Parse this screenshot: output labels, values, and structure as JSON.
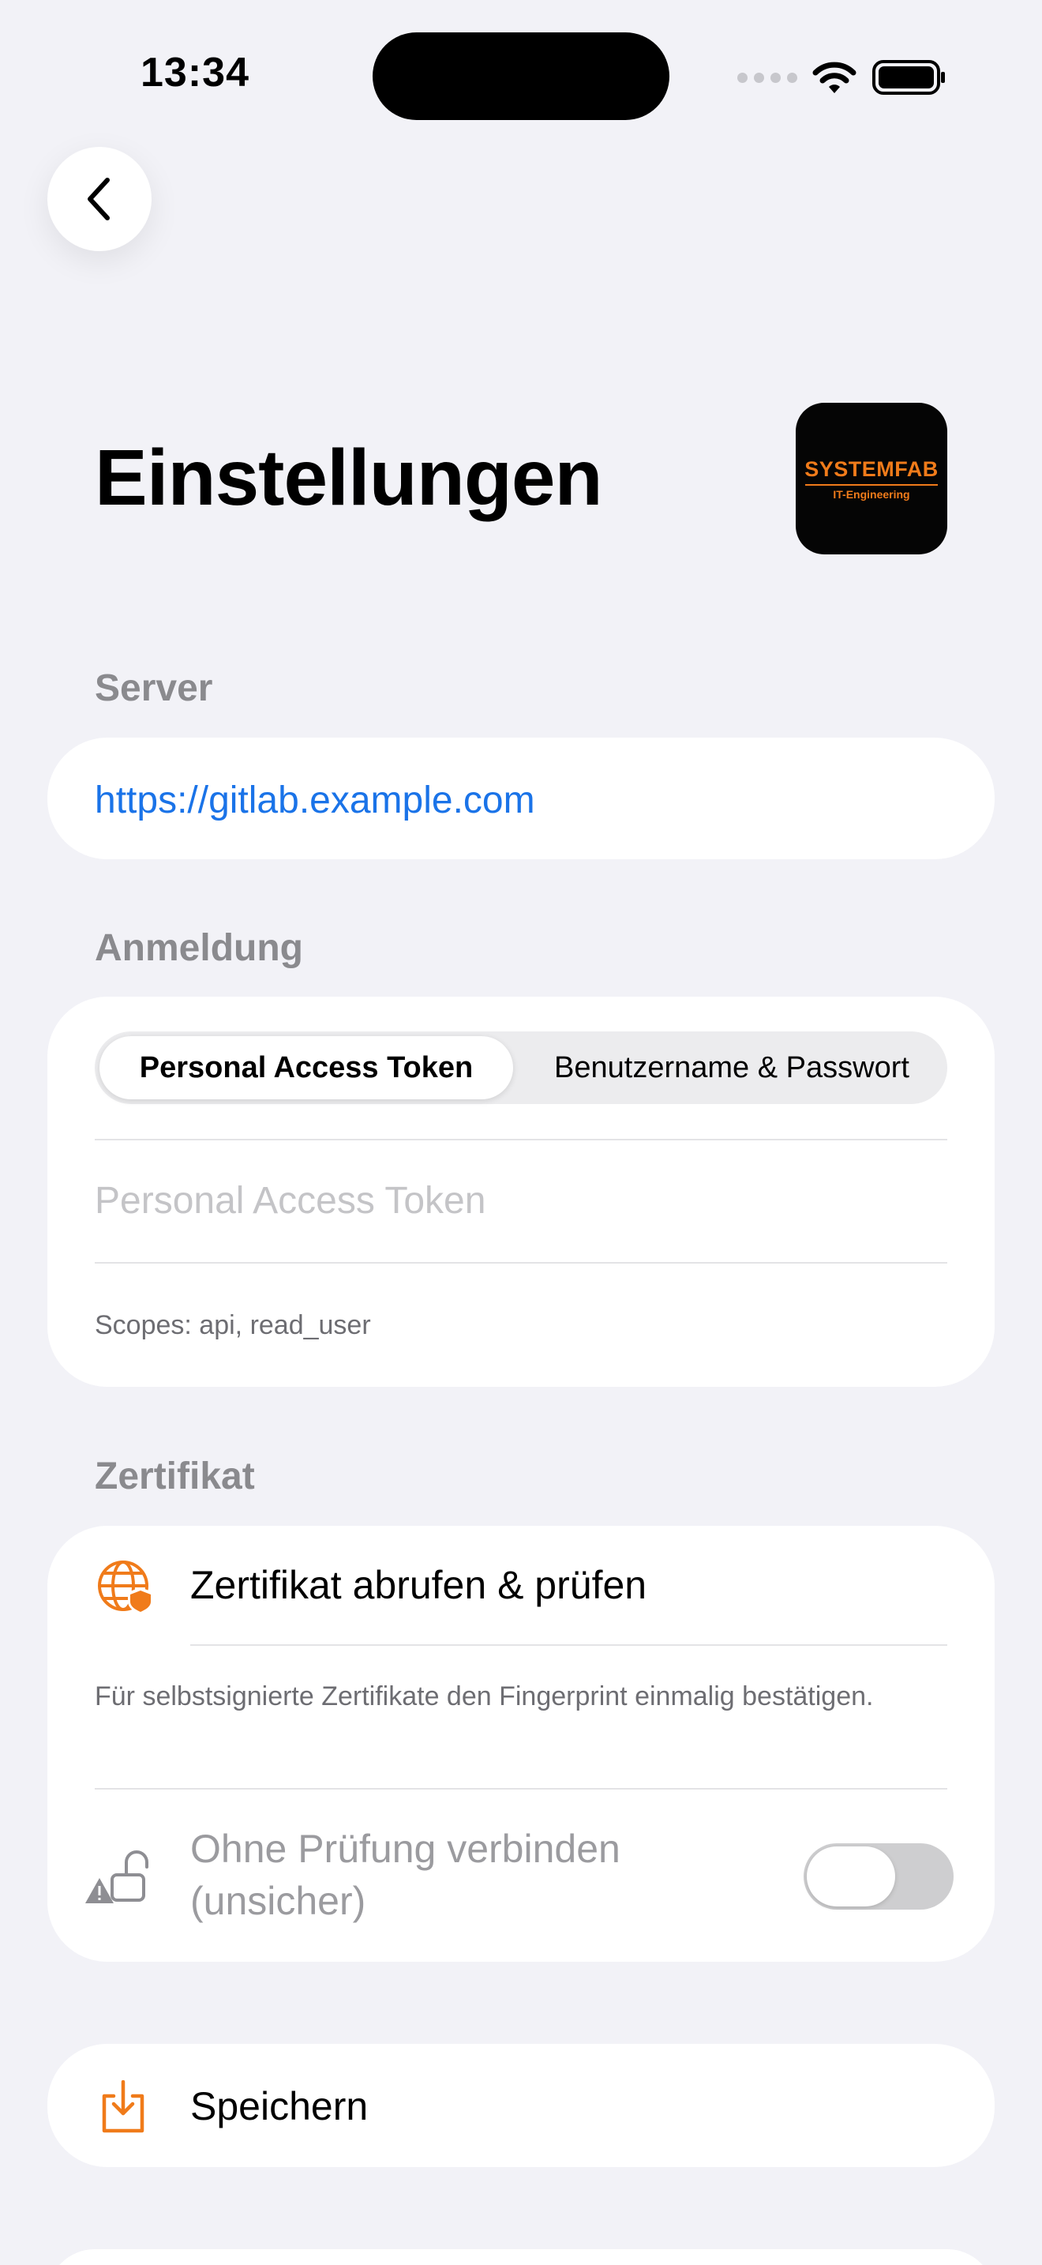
{
  "status_bar": {
    "time": "13:34"
  },
  "page": {
    "title": "Einstellungen",
    "logo": {
      "main": "SYSTEMFAB",
      "sub": "IT-Engineering"
    }
  },
  "server": {
    "section_title": "Server",
    "url": "https://gitlab.example.com"
  },
  "login": {
    "section_title": "Anmeldung",
    "segments": [
      "Personal Access Token",
      "Benutzername & Passwort"
    ],
    "selected_segment": "Personal Access Token",
    "token_placeholder": "Personal Access Token",
    "token_value": "",
    "scopes_note": "Scopes: api, read_user"
  },
  "certificate": {
    "section_title": "Zertifikat",
    "fetch_label": "Zertifikat abrufen & prüfen",
    "note": "Für selbstsignierte Zertifikate den Fingerprint einmalig bestätigen.",
    "insecure_label_line1": "Ohne Prüfung verbinden",
    "insecure_label_line2": "(unsicher)",
    "insecure_enabled": false
  },
  "actions": {
    "save_label": "Speichern"
  },
  "colors": {
    "accent": "#f07b1a",
    "link": "#1a73e8",
    "background": "#f2f2f7"
  },
  "icons": {
    "back": "chevron-left-icon",
    "certificate": "globe-shield-icon",
    "insecure": "unlocked-warning-icon",
    "save": "download-tray-icon"
  }
}
